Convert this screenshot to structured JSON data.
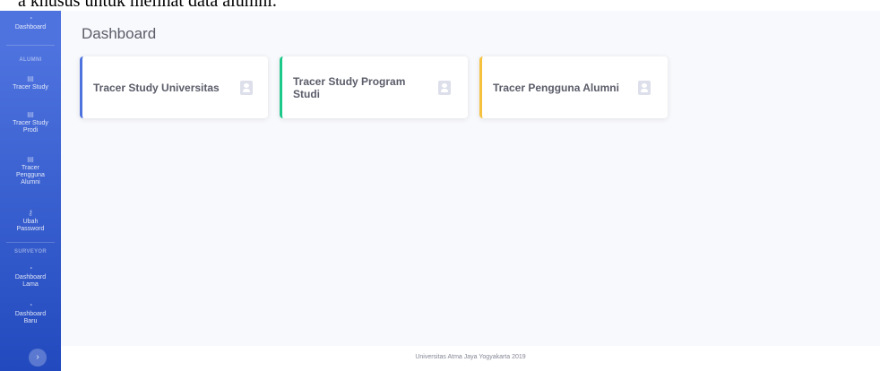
{
  "document_text": "a khusus untuk melihat data alumni.",
  "sidebar": {
    "brand_label": "Dashboard",
    "sections": [
      {
        "heading": "ALUMNI"
      },
      {
        "heading": "SURVEYOR"
      }
    ],
    "items": [
      {
        "label": "Tracer Study",
        "icon": "id-card-icon"
      },
      {
        "label": "Tracer Study Prodi",
        "icon": "id-card-icon"
      },
      {
        "label": "Tracer Pengguna Alumni",
        "icon": "id-card-icon"
      },
      {
        "label": "Ubah Password",
        "icon": "key-icon"
      },
      {
        "label": "Dashboard Lama",
        "icon": "tachometer-icon"
      },
      {
        "label": "Dashboard Baru",
        "icon": "tachometer-icon"
      }
    ],
    "toggle_icon": "chevron-right-icon"
  },
  "main": {
    "title": "Dashboard",
    "cards": [
      {
        "title": "Tracer Study Universitas",
        "accent": "#4e73df",
        "icon": "id-card-icon"
      },
      {
        "title": "Tracer Study Program Studi",
        "accent": "#1cc88a",
        "icon": "id-card-icon"
      },
      {
        "title": "Tracer Pengguna Alumni",
        "accent": "#f6c23e",
        "icon": "id-card-icon"
      }
    ]
  },
  "footer": {
    "text": "Universitas Atma Jaya Yogyakarta 2019"
  },
  "colors": {
    "primary": "#4e73df",
    "success": "#1cc88a",
    "warning": "#f6c23e",
    "text": "#5a5c69"
  }
}
